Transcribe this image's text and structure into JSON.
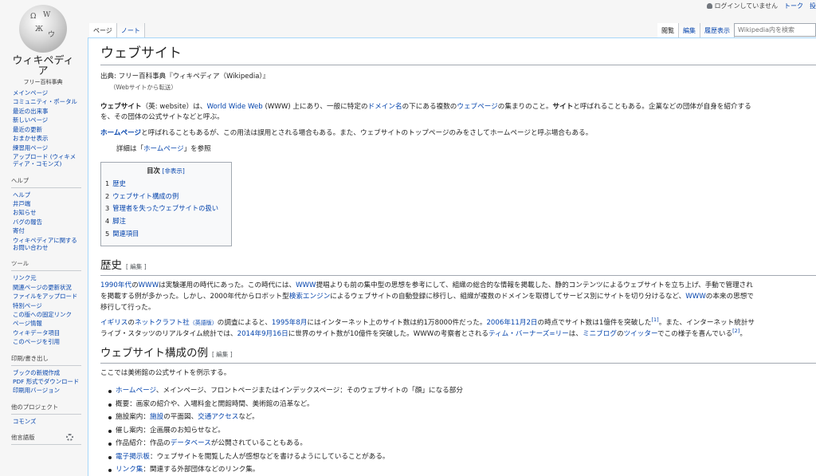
{
  "personal": {
    "not_logged_in": "ログインしていません",
    "talk": "トーク",
    "contributions": "投"
  },
  "logo": {
    "wordmark": "ウィキペディア",
    "tagline": "フリー百科事典",
    "globe_glyphs": [
      "Ω",
      "W",
      "Ж",
      "ウ"
    ]
  },
  "sidebar": {
    "navigation": [
      "メインページ",
      "コミュニティ・ポータル",
      "最近の出来事",
      "新しいページ",
      "最近の更新",
      "おまかせ表示",
      "練習用ページ",
      "アップロード (ウィキメディア・コモンズ)"
    ],
    "help_heading": "ヘルプ",
    "help": [
      "ヘルプ",
      "井戸端",
      "お知らせ",
      "バグの報告",
      "寄付",
      "ウィキペディアに関するお問い合わせ"
    ],
    "tools_heading": "ツール",
    "tools": [
      "リンク元",
      "関連ページの更新状況",
      "ファイルをアップロード",
      "特別ページ",
      "この版への固定リンク",
      "ページ情報",
      "ウィキデータ項目",
      "このページを引用"
    ],
    "print_heading": "印刷/書き出し",
    "print": [
      "ブックの新規作成",
      "PDF 形式でダウンロード",
      "印刷用バージョン"
    ],
    "projects_heading": "他のプロジェクト",
    "projects": [
      "コモンズ"
    ],
    "languages_heading": "他言語版"
  },
  "tabs": {
    "page": "ページ",
    "talk": "ノート",
    "read": "閲覧",
    "edit": "編集",
    "history": "履歴表示"
  },
  "search": {
    "placeholder": "Wikipedia内を検索"
  },
  "article": {
    "title": "ウェブサイト",
    "site_sub": "出典: フリー百科事典『ウィキペディア（Wikipedia）』",
    "redirect_note": "（Webサイトから転送）",
    "lead1_line1": {
      "b1": "ウェブサイト",
      "t1": "（英: website）は、",
      "l1": "World Wide Web",
      "t2": " (WWW) 上にあり、一般に特定の",
      "l2": "ドメイン名",
      "t3": "の下にある複数の",
      "l3": "ウェブページ",
      "t4": "の集まりのこと。",
      "b2": "サイト",
      "t5": "と呼ばれることもある。企業などの団体が自身を紹介する"
    },
    "lead1_line2": "を、その団体の公式サイトなどと呼ぶ。",
    "lead2": {
      "l1": "ホームページ",
      "t1": "と呼ばれることもあるが、この用法は誤用とされる場合もある。また、ウェブサイトのトップページのみをさしてホームページと呼ぶ場合もある。"
    },
    "hatnote": {
      "t1": "詳細は「",
      "l1": "ホームページ",
      "t2": "」を参照"
    },
    "toc": {
      "title": "目次",
      "toggle": "[非表示]",
      "items": [
        {
          "num": "1",
          "label": "歴史"
        },
        {
          "num": "2",
          "label": "ウェブサイト構成の例"
        },
        {
          "num": "3",
          "label": "管理者を失ったウェブサイトの扱い"
        },
        {
          "num": "4",
          "label": "脚注"
        },
        {
          "num": "5",
          "label": "関連項目"
        }
      ]
    },
    "history": {
      "heading": "歴史",
      "edit": "[ 編集 ]",
      "p1_line1": {
        "l1": "1990年代",
        "t1": "の",
        "l2": "WWW",
        "t2": "は実験運用の時代にあった。この時代には、",
        "l3": "WWW",
        "t3": "提唱よりも前の集中型の思想を参考にして、組織の総合的な情報を掲載した、静的コンテンツによるウェブサイトを立ち上げ、手動で管理され"
      },
      "p1_line2": {
        "t1": "を掲載する例が多かった。しかし、2000年代からロボット型",
        "l1": "検索エンジン",
        "t2": "によるウェブサイトの自動登録に移行し、組織が複数のドメインを取得してサービス別にサイトを切り分けるなど、",
        "l2": "WWW",
        "t3": "の本来の思想で"
      },
      "p1_line3": "移行して行った。",
      "p2_line1": {
        "l1": "イギリス",
        "t1": "の",
        "l2": "ネットクラフト社",
        "lang": "（英語版）",
        "t2": "の調査によると、",
        "l3": "1995年",
        "l4": "8月",
        "t3": "にはインターネット上のサイト数は約1万8000件だった。",
        "l5": "2006年",
        "l6": "11月2日",
        "t4": "の時点でサイト数は1億件を突破した",
        "ref1": "[1]",
        "t5": "。また、インターネット統計サ"
      },
      "p2_line2": {
        "t1": "ライブ・スタッツのリアルタイム統計では、",
        "l1": "2014年",
        "l2": "9月16日",
        "t2": "に世界のサイト数が10億件を突破した。WWWの考察者とされる",
        "l3": "ティム・バーナーズ=リー",
        "t3": "は、",
        "l4": "ミニブログ",
        "t4": "の",
        "l5": "ツイッター",
        "t5": "でこの様子を喜んでいる",
        "ref2": "[2]",
        "t6": "。"
      }
    },
    "example": {
      "heading": "ウェブサイト構成の例",
      "edit": "[ 編集 ]",
      "intro": "ここでは美術館の公式サイトを例示する。",
      "items": [
        {
          "link": "ホームページ",
          "text": "、メインページ、フロントページまたはインデックスページ：そのウェブサイトの「顔」になる部分"
        },
        {
          "pre": "概要：画家の紹介や、入場料金と開館時間、美術館の沿革など。"
        },
        {
          "pre": "施設案内：",
          "link": "施設",
          "text": "の平面図、",
          "link2": "交通アクセス",
          "text2": "など。"
        },
        {
          "pre": "催し案内：企画展のお知らせなど。"
        },
        {
          "pre": "作品紹介：作品の",
          "link": "データベース",
          "text": "が公開されていることもある。"
        },
        {
          "link": "電子掲示板",
          "text": "：ウェブサイトを閲覧した人が感想などを書けるようにしていることがある。"
        },
        {
          "link": "リンク集",
          "text": "：関連する外部団体などのリンク集。"
        }
      ]
    }
  }
}
